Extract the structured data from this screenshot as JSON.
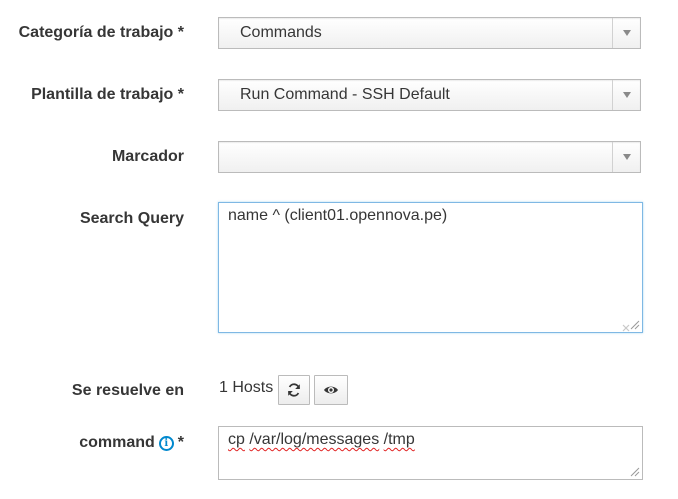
{
  "fields": {
    "job_category": {
      "label": "Categoría de trabajo *",
      "value": "Commands"
    },
    "job_template": {
      "label": "Plantilla de trabajo *",
      "value": "Run Command - SSH Default"
    },
    "bookmark": {
      "label": "Marcador",
      "value": ""
    },
    "search_query": {
      "label": "Search Query",
      "value": "name ^ (client01.opennova.pe)"
    },
    "resolves_to": {
      "label": "Se resuelve en",
      "hosts_text": "1 Hosts"
    },
    "command": {
      "label_text": "command",
      "required_mark": "*",
      "tokens": [
        "cp",
        " ",
        "/var/log/messages",
        " ",
        "/tmp"
      ]
    }
  },
  "icons": {
    "dropdown": "chevron-down-icon",
    "refresh": "refresh-icon",
    "preview": "eye-icon",
    "info": "info-icon",
    "resize": "resize-grip-icon"
  },
  "colors": {
    "label": "#363636",
    "focus_border": "#7fb8e4",
    "info_blue": "#0088ce",
    "spell_error": "#e02020"
  }
}
